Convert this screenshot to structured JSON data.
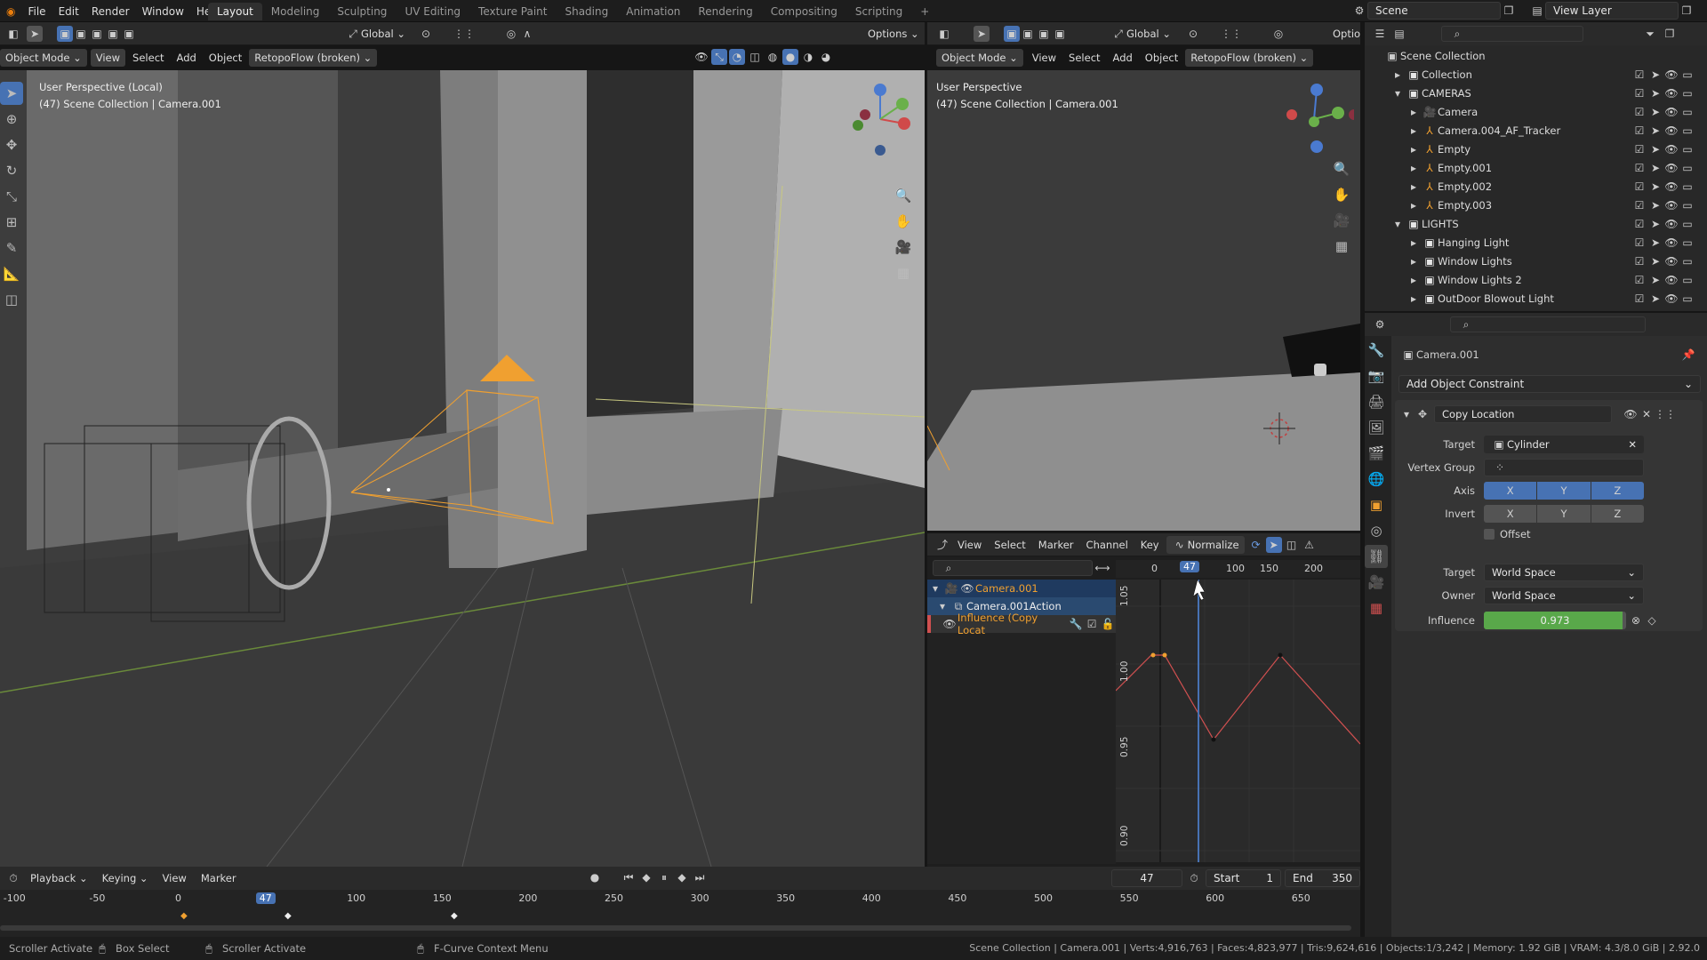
{
  "menu": {
    "items": [
      "File",
      "Edit",
      "Render",
      "Window",
      "Help"
    ]
  },
  "workspaces": {
    "tabs": [
      "Layout",
      "Modeling",
      "Sculpting",
      "UV Editing",
      "Texture Paint",
      "Shading",
      "Animation",
      "Rendering",
      "Compositing",
      "Scripting",
      "+"
    ],
    "active": "Layout"
  },
  "top_right": {
    "scene": "Scene",
    "view_layer": "View Layer"
  },
  "viewport_left": {
    "header": {
      "transform": "Global",
      "options": "Options",
      "mode": "Object Mode",
      "view": "View",
      "select": "Select",
      "add": "Add",
      "object": "Object",
      "addon": "RetopoFlow (broken)"
    },
    "overlay_line1": "User Perspective (Local)",
    "overlay_line2": "(47) Scene Collection | Camera.001"
  },
  "viewport_right": {
    "header": {
      "transform": "Global",
      "options": "Optio",
      "mode": "Object Mode",
      "view": "View",
      "select": "Select",
      "add": "Add",
      "object": "Object",
      "addon": "RetopoFlow (broken)"
    },
    "overlay_line1": "User Perspective",
    "overlay_line2": "(47) Scene Collection | Camera.001"
  },
  "graph_editor": {
    "menu": [
      "View",
      "Select",
      "Marker",
      "Channel",
      "Key"
    ],
    "normalize": "Normalize",
    "frame_ticks": [
      "0",
      "47",
      "100",
      "150",
      "200"
    ],
    "channels": [
      {
        "label": "Camera.001",
        "level": 0
      },
      {
        "label": "Camera.001Action",
        "level": 1
      },
      {
        "label": "Influence (Copy Locat",
        "level": 2
      }
    ],
    "y_ticks": [
      "1.05",
      "1.00",
      "0.95",
      "0.90"
    ],
    "current_frame": "47"
  },
  "outliner": {
    "root": "Scene Collection",
    "rows": [
      {
        "label": "Collection",
        "indent": 1,
        "type": "collection"
      },
      {
        "label": "CAMERAS",
        "indent": 1,
        "type": "collection"
      },
      {
        "label": "Camera",
        "indent": 2,
        "type": "camera"
      },
      {
        "label": "Camera.004_AF_Tracker",
        "indent": 2,
        "type": "empty"
      },
      {
        "label": "Empty",
        "indent": 2,
        "type": "empty"
      },
      {
        "label": "Empty.001",
        "indent": 2,
        "type": "empty"
      },
      {
        "label": "Empty.002",
        "indent": 2,
        "type": "empty"
      },
      {
        "label": "Empty.003",
        "indent": 2,
        "type": "empty"
      },
      {
        "label": "LIGHTS",
        "indent": 1,
        "type": "collection"
      },
      {
        "label": "Hanging Light",
        "indent": 2,
        "type": "collection"
      },
      {
        "label": "Window Lights",
        "indent": 2,
        "type": "collection"
      },
      {
        "label": "Window Lights 2",
        "indent": 2,
        "type": "collection"
      },
      {
        "label": "OutDoor Blowout Light",
        "indent": 2,
        "type": "collection"
      }
    ]
  },
  "properties": {
    "object_name": "Camera.001",
    "add_constraint": "Add Object Constraint",
    "constraint_name": "Copy Location",
    "target_label": "Target",
    "target_value": "Cylinder",
    "vertex_group_label": "Vertex Group",
    "axis_label": "Axis",
    "invert_label": "Invert",
    "axes": [
      "X",
      "Y",
      "Z"
    ],
    "offset_label": "Offset",
    "target_space_label": "Target",
    "target_space": "World Space",
    "owner_space_label": "Owner",
    "owner_space": "World Space",
    "influence_label": "Influence",
    "influence_value": "0.973",
    "influence_fraction": 0.973
  },
  "timeline": {
    "menu": [
      "Playback",
      "Keying",
      "View",
      "Marker"
    ],
    "current": "47",
    "start_label": "Start",
    "start": "1",
    "end_label": "End",
    "end": "350",
    "ticks": [
      "-100",
      "-50",
      "0",
      "47",
      "100",
      "150",
      "200",
      "250",
      "300",
      "350",
      "400",
      "450",
      "500",
      "550",
      "600",
      "650"
    ]
  },
  "statusbar": {
    "left1": "Scroller Activate",
    "left2": "Box Select",
    "left3": "Scroller Activate",
    "mid": "F-Curve Context Menu",
    "right": "Scene Collection | Camera.001 | Verts:4,916,763 | Faces:4,823,977 | Tris:9,624,616 | Objects:1/3,242 | Memory: 1.92 GiB | VRAM: 4.3/8.0 GiB | 2.92.0"
  },
  "colors": {
    "accent": "#4772b3",
    "influence": "#59a84a",
    "selected_orange": "#f0a030",
    "curve": "#d05050"
  }
}
